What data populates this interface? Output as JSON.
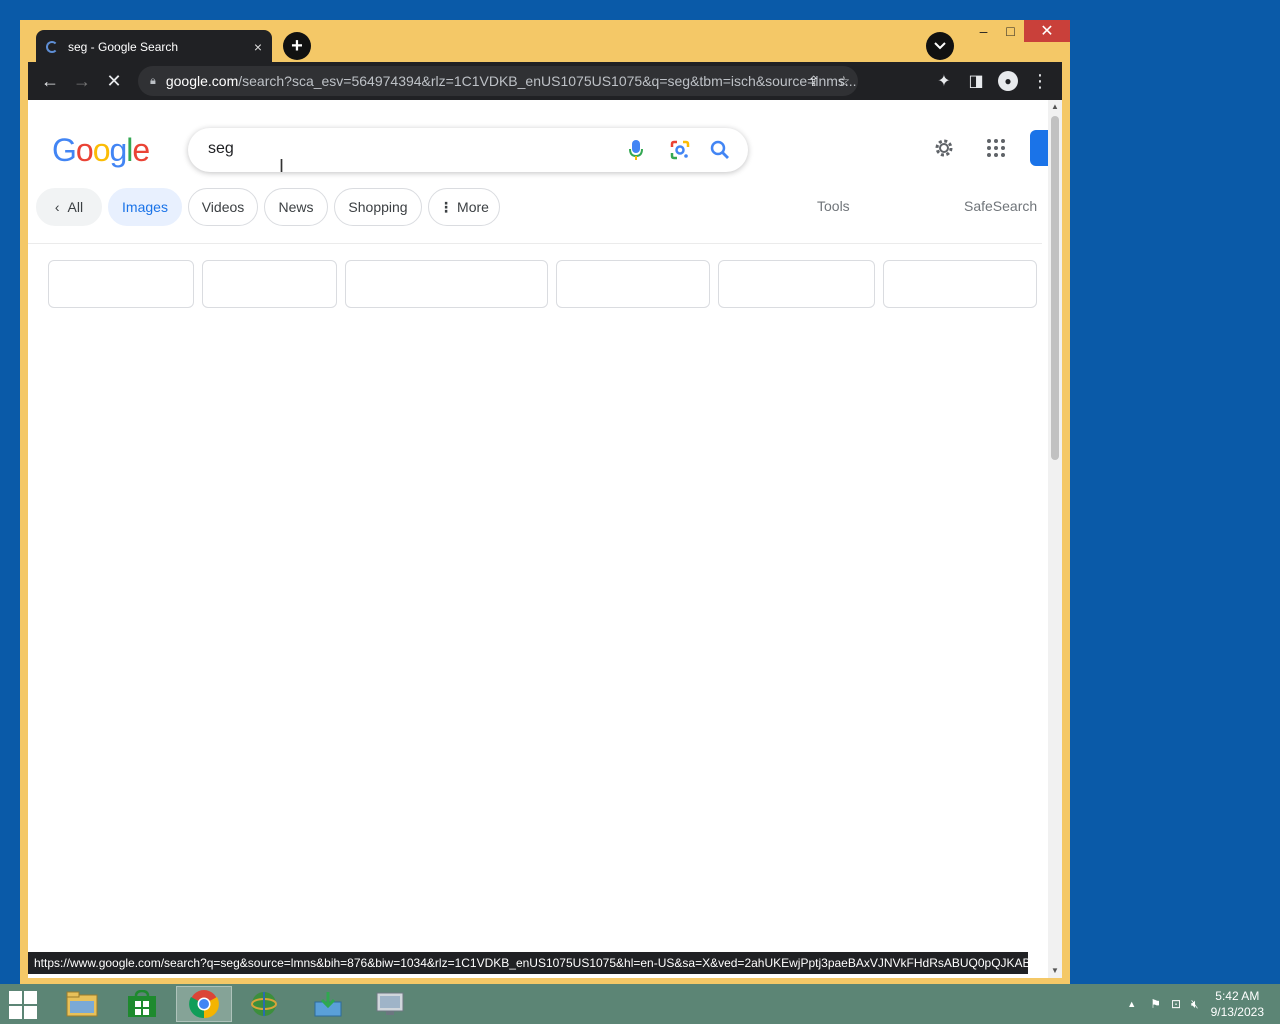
{
  "browser": {
    "tab": {
      "title": "seg - Google Search",
      "close_glyph": "×"
    },
    "new_tab_glyph": "+",
    "tab_search_glyph": "⌄",
    "window_controls": {
      "minimize": "–",
      "maximize": "□",
      "close": "✕"
    },
    "toolbar": {
      "back_glyph": "←",
      "forward_glyph": "→",
      "stop_glyph": "✕",
      "url_host": "google.com",
      "url_rest": "/search?sca_esv=564974394&rlz=1C1VDKB_enUS1075US1075&q=seg&tbm=isch&source=lnms...",
      "share_glyph": "⇪",
      "star_glyph": "☆",
      "extensions_glyph": "✦",
      "sidepanel_glyph": "◨",
      "menu_glyph": "⋮"
    },
    "status_url": "https://www.google.com/search?q=seg&source=lmns&bih=876&biw=1034&rlz=1C1VDKB_enUS1075US1075&hl=en-US&sa=X&ved=2ahUKEwjPptj3paeBAxVJNVkFHdRsABUQ0pQJKAB..."
  },
  "google": {
    "logo_letters": [
      {
        "ch": "G",
        "color": "#4285f4"
      },
      {
        "ch": "o",
        "color": "#ea4335"
      },
      {
        "ch": "o",
        "color": "#fbbc05"
      },
      {
        "ch": "g",
        "color": "#4285f4"
      },
      {
        "ch": "l",
        "color": "#34a853"
      },
      {
        "ch": "e",
        "color": "#ea4335"
      }
    ],
    "search_query": "seg",
    "chips": {
      "back": "All",
      "images": "Images",
      "videos": "Videos",
      "news": "News",
      "shopping": "Shopping",
      "more": "More"
    },
    "tools": "Tools",
    "safesearch": "SafeSearch"
  },
  "taskbar": {
    "time": "5:42 AM",
    "date": "9/13/2023",
    "tray_arrow": "▲"
  },
  "colors": {
    "desktop": "#0a5aa8",
    "window_frame": "#f4c867",
    "taskbar": "#5c8575",
    "google_blue": "#1a73e8"
  }
}
